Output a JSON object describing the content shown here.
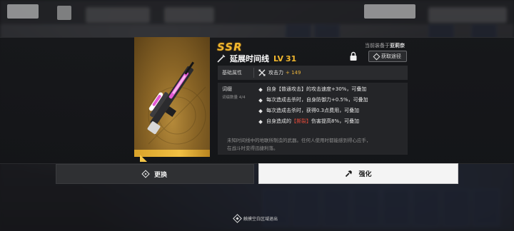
{
  "weapon": {
    "rarity": "SSR",
    "name": "延展时间线",
    "level_label": "LV",
    "level": "31",
    "equipped_prefix": "当前装备于",
    "equipped_by": "亚莉奈"
  },
  "actions": {
    "source_label": "获取途径",
    "swap_label": "更换",
    "upgrade_label": "强化"
  },
  "base_attr": {
    "label": "基础属性",
    "stat_name": "攻击力",
    "stat_value": "+ 149"
  },
  "affix": {
    "title": "词缀",
    "count_label": "词缀数量 4/4",
    "lines": [
      {
        "pre": "自身【普通攻击】的攻击速度+30%，可叠加",
        "red": "",
        "post": ""
      },
      {
        "pre": "每次造成击杀时，自身防御力+0.5%，可叠加",
        "red": "",
        "post": ""
      },
      {
        "pre": "每次造成击杀时，获得0.3点费用，可叠加",
        "red": "",
        "post": ""
      },
      {
        "pre": "自身造成的",
        "red": "【撕裂】",
        "post": "伤害提高8%，可叠加"
      }
    ],
    "flavor_1": "未知时间线中的地联所制造的武器。任何人使用时都能感到得心应手，",
    "flavor_2": "在战斗时变得迅捷利落。"
  },
  "hint": "触摸空白区域退出",
  "colors": {
    "rarity": "#f1b72e",
    "highlight_red": "#e14a3a",
    "stat_value": "#e9b23a"
  },
  "icons": [
    "weapon-type-icon",
    "lock-icon",
    "source-diamond-icon",
    "attack-icon",
    "swap-icon",
    "upgrade-hammer-icon",
    "exit-hint-icon"
  ]
}
